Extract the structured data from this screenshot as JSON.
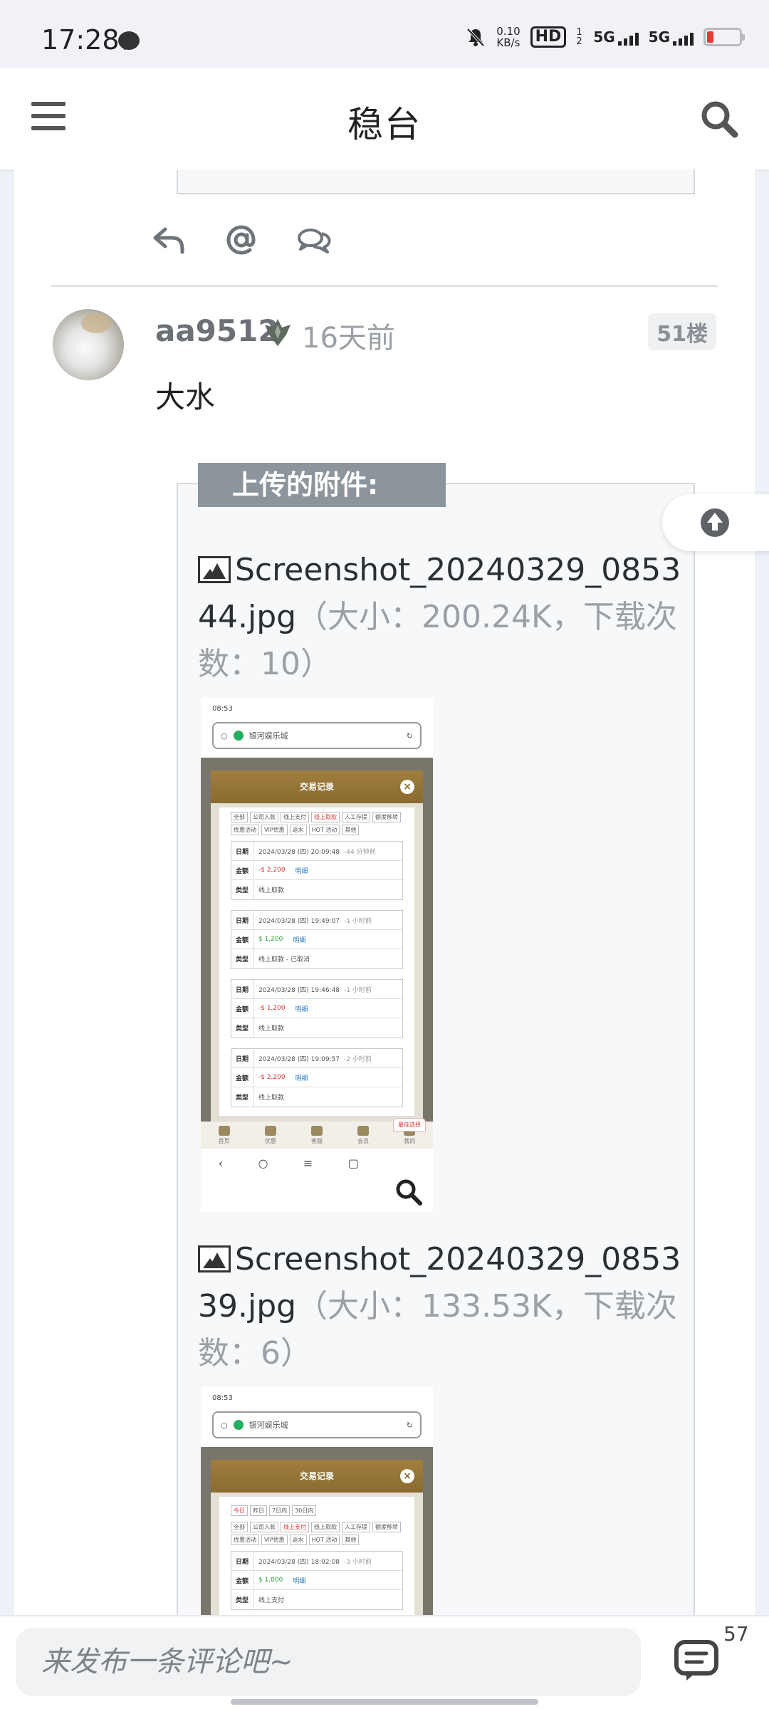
{
  "status_bar": {
    "time": "17:28",
    "net_speed_value": "0.10",
    "net_speed_unit": "KB/s",
    "hd_label": "HD",
    "hd_sub": "1 2",
    "sim1": "5G",
    "sim2": "5G",
    "battery_color": "#e53935"
  },
  "header": {
    "title": "稳台",
    "menu_icon": "menu-icon",
    "search_icon": "search-icon"
  },
  "post": {
    "username": "aa9512",
    "time": "16天前",
    "floor": "51楼",
    "body": "大水",
    "attachments_label": "上传的附件:",
    "attachments": [
      {
        "filename": "Screenshot_20240329_085344.jpg",
        "meta": "（大小：200.24K，下载次数：10）"
      },
      {
        "filename": "Screenshot_20240329_085339.jpg",
        "meta": "（大小：133.53K，下载次数：6）"
      }
    ]
  },
  "thumb1": {
    "time": "08:53",
    "site": "银河娱乐城",
    "modal_title": "交易记录",
    "filters": [
      "全部",
      "公司入款",
      "线上支付",
      "线上取款",
      "人工存提",
      "额度移转",
      "优惠活动",
      "VIP优惠",
      "返水",
      "HOT 活动",
      "其他"
    ],
    "labels": {
      "date": "日期",
      "amount": "金额",
      "type": "类型",
      "detail": "明细"
    },
    "records": [
      {
        "date": "2024/03/28 (四) 20:09:48",
        "ago": "-44 分钟前",
        "amount": "-$ 2,200",
        "type": "线上取款"
      },
      {
        "date": "2024/03/28 (四) 19:49:07",
        "ago": "-1 小时前",
        "amount": "$ 1,200",
        "type": "线上取款 - 已取消"
      },
      {
        "date": "2024/03/28 (四) 19:46:48",
        "ago": "-1 小时前",
        "amount": "-$ 1,200",
        "type": "线上取款"
      },
      {
        "date": "2024/03/28 (四) 19:09:57",
        "ago": "-2 小时前",
        "amount": "-$ 2,200",
        "type": "线上取款"
      }
    ],
    "badge": "最佳选择",
    "nav": [
      "首页",
      "优惠",
      "客服",
      "会员",
      "我的"
    ]
  },
  "thumb2": {
    "time": "08:53",
    "site": "银河娱乐城",
    "modal_title": "交易记录",
    "ranges": [
      "今日",
      "昨日",
      "7日内",
      "30日内"
    ],
    "filters": [
      "全部",
      "公司入款",
      "线上支付",
      "线上取款",
      "人工存提",
      "额度移转",
      "优惠活动",
      "VIP优惠",
      "返水",
      "HOT 活动",
      "其他"
    ],
    "labels": {
      "date": "日期",
      "amount": "金额",
      "type": "类型",
      "detail": "明细"
    },
    "record": {
      "date": "2024/03/28 (四) 18:02:08",
      "ago": "-3 小时前",
      "amount": "$ 1,000",
      "type": "线上支付"
    }
  },
  "bottom_bar": {
    "placeholder": "来发布一条评论吧~",
    "comment_count": "57"
  }
}
